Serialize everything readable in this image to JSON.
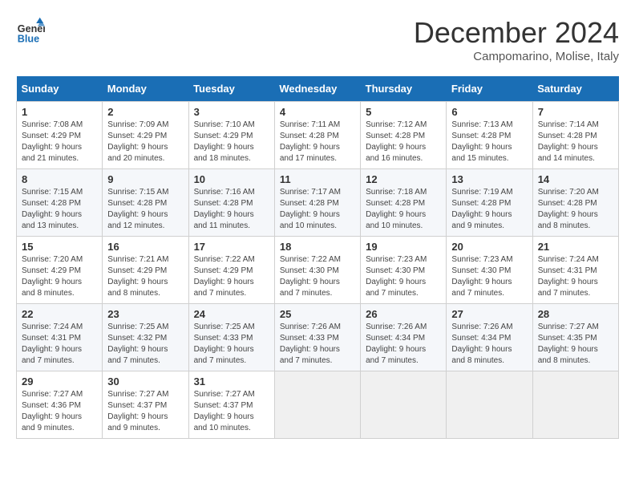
{
  "logo": {
    "line1": "General",
    "line2": "Blue"
  },
  "title": "December 2024",
  "subtitle": "Campomarino, Molise, Italy",
  "days_of_week": [
    "Sunday",
    "Monday",
    "Tuesday",
    "Wednesday",
    "Thursday",
    "Friday",
    "Saturday"
  ],
  "weeks": [
    [
      {
        "day": "1",
        "info": "Sunrise: 7:08 AM\nSunset: 4:29 PM\nDaylight: 9 hours\nand 21 minutes."
      },
      {
        "day": "2",
        "info": "Sunrise: 7:09 AM\nSunset: 4:29 PM\nDaylight: 9 hours\nand 20 minutes."
      },
      {
        "day": "3",
        "info": "Sunrise: 7:10 AM\nSunset: 4:29 PM\nDaylight: 9 hours\nand 18 minutes."
      },
      {
        "day": "4",
        "info": "Sunrise: 7:11 AM\nSunset: 4:28 PM\nDaylight: 9 hours\nand 17 minutes."
      },
      {
        "day": "5",
        "info": "Sunrise: 7:12 AM\nSunset: 4:28 PM\nDaylight: 9 hours\nand 16 minutes."
      },
      {
        "day": "6",
        "info": "Sunrise: 7:13 AM\nSunset: 4:28 PM\nDaylight: 9 hours\nand 15 minutes."
      },
      {
        "day": "7",
        "info": "Sunrise: 7:14 AM\nSunset: 4:28 PM\nDaylight: 9 hours\nand 14 minutes."
      }
    ],
    [
      {
        "day": "8",
        "info": "Sunrise: 7:15 AM\nSunset: 4:28 PM\nDaylight: 9 hours\nand 13 minutes."
      },
      {
        "day": "9",
        "info": "Sunrise: 7:15 AM\nSunset: 4:28 PM\nDaylight: 9 hours\nand 12 minutes."
      },
      {
        "day": "10",
        "info": "Sunrise: 7:16 AM\nSunset: 4:28 PM\nDaylight: 9 hours\nand 11 minutes."
      },
      {
        "day": "11",
        "info": "Sunrise: 7:17 AM\nSunset: 4:28 PM\nDaylight: 9 hours\nand 10 minutes."
      },
      {
        "day": "12",
        "info": "Sunrise: 7:18 AM\nSunset: 4:28 PM\nDaylight: 9 hours\nand 10 minutes."
      },
      {
        "day": "13",
        "info": "Sunrise: 7:19 AM\nSunset: 4:28 PM\nDaylight: 9 hours\nand 9 minutes."
      },
      {
        "day": "14",
        "info": "Sunrise: 7:20 AM\nSunset: 4:28 PM\nDaylight: 9 hours\nand 8 minutes."
      }
    ],
    [
      {
        "day": "15",
        "info": "Sunrise: 7:20 AM\nSunset: 4:29 PM\nDaylight: 9 hours\nand 8 minutes."
      },
      {
        "day": "16",
        "info": "Sunrise: 7:21 AM\nSunset: 4:29 PM\nDaylight: 9 hours\nand 8 minutes."
      },
      {
        "day": "17",
        "info": "Sunrise: 7:22 AM\nSunset: 4:29 PM\nDaylight: 9 hours\nand 7 minutes."
      },
      {
        "day": "18",
        "info": "Sunrise: 7:22 AM\nSunset: 4:30 PM\nDaylight: 9 hours\nand 7 minutes."
      },
      {
        "day": "19",
        "info": "Sunrise: 7:23 AM\nSunset: 4:30 PM\nDaylight: 9 hours\nand 7 minutes."
      },
      {
        "day": "20",
        "info": "Sunrise: 7:23 AM\nSunset: 4:30 PM\nDaylight: 9 hours\nand 7 minutes."
      },
      {
        "day": "21",
        "info": "Sunrise: 7:24 AM\nSunset: 4:31 PM\nDaylight: 9 hours\nand 7 minutes."
      }
    ],
    [
      {
        "day": "22",
        "info": "Sunrise: 7:24 AM\nSunset: 4:31 PM\nDaylight: 9 hours\nand 7 minutes."
      },
      {
        "day": "23",
        "info": "Sunrise: 7:25 AM\nSunset: 4:32 PM\nDaylight: 9 hours\nand 7 minutes."
      },
      {
        "day": "24",
        "info": "Sunrise: 7:25 AM\nSunset: 4:33 PM\nDaylight: 9 hours\nand 7 minutes."
      },
      {
        "day": "25",
        "info": "Sunrise: 7:26 AM\nSunset: 4:33 PM\nDaylight: 9 hours\nand 7 minutes."
      },
      {
        "day": "26",
        "info": "Sunrise: 7:26 AM\nSunset: 4:34 PM\nDaylight: 9 hours\nand 7 minutes."
      },
      {
        "day": "27",
        "info": "Sunrise: 7:26 AM\nSunset: 4:34 PM\nDaylight: 9 hours\nand 8 minutes."
      },
      {
        "day": "28",
        "info": "Sunrise: 7:27 AM\nSunset: 4:35 PM\nDaylight: 9 hours\nand 8 minutes."
      }
    ],
    [
      {
        "day": "29",
        "info": "Sunrise: 7:27 AM\nSunset: 4:36 PM\nDaylight: 9 hours\nand 9 minutes."
      },
      {
        "day": "30",
        "info": "Sunrise: 7:27 AM\nSunset: 4:37 PM\nDaylight: 9 hours\nand 9 minutes."
      },
      {
        "day": "31",
        "info": "Sunrise: 7:27 AM\nSunset: 4:37 PM\nDaylight: 9 hours\nand 10 minutes."
      },
      null,
      null,
      null,
      null
    ]
  ]
}
